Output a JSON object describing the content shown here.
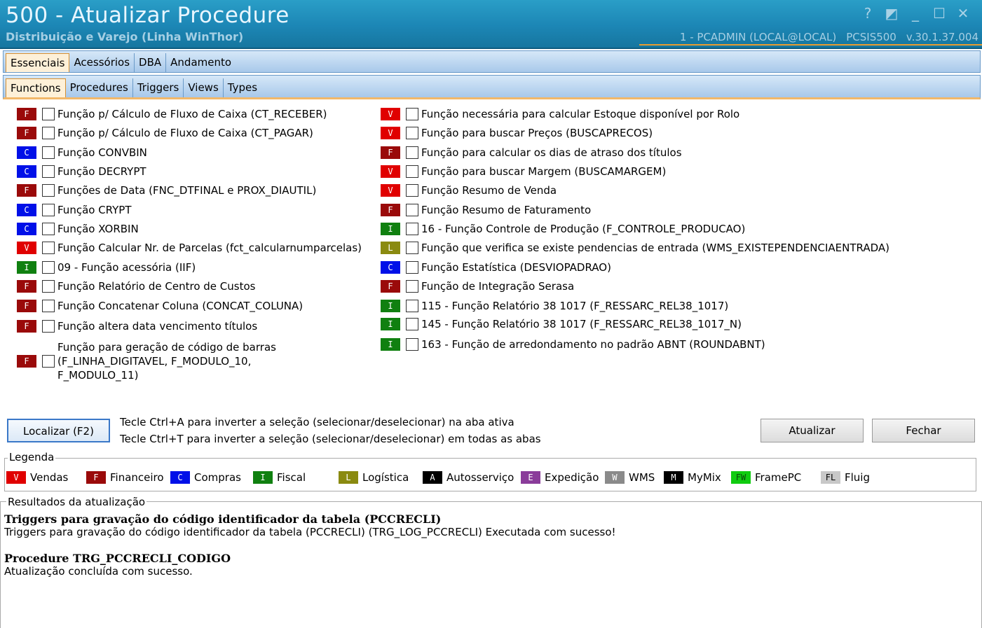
{
  "window": {
    "title": "500 - Atualizar Procedure",
    "subtitle": "Distribuição e Varejo (Linha WinThor)",
    "user": "1 - PCADMIN (LOCAL@LOCAL)",
    "program": "PCSIS500",
    "version": "v.30.1.37.004",
    "controls": [
      "?",
      "◩",
      "_",
      "☐",
      "✕"
    ]
  },
  "tabs_main": [
    {
      "label": "Essenciais",
      "active": true
    },
    {
      "label": "Acessórios",
      "active": false
    },
    {
      "label": "DBA",
      "active": false
    },
    {
      "label": "Andamento",
      "active": false
    }
  ],
  "tabs_sub": [
    {
      "label": "Functions",
      "active": true
    },
    {
      "label": "Procedures",
      "active": false
    },
    {
      "label": "Triggers",
      "active": false
    },
    {
      "label": "Views",
      "active": false
    },
    {
      "label": "Types",
      "active": false
    }
  ],
  "colors": {
    "V": "#e00000",
    "F": "#9a0a0a",
    "C": "#0010e8",
    "I": "#108010",
    "L": "#8a8a10",
    "A": "#000000",
    "E": "#8a3c9a",
    "W": "#8a8a8a",
    "M": "#000000",
    "FW": "#10cc10",
    "FL": "#c8c8c8"
  },
  "functions_left": [
    {
      "type": "F",
      "label": "Função p/ Cálculo de Fluxo de Caixa (CT_RECEBER)"
    },
    {
      "type": "F",
      "label": "Função p/ Cálculo de Fluxo de Caixa (CT_PAGAR)"
    },
    {
      "type": "C",
      "label": "Função CONVBIN"
    },
    {
      "type": "C",
      "label": "Função DECRYPT"
    },
    {
      "type": "F",
      "label": "Funções de Data (FNC_DTFINAL e PROX_DIAUTIL)"
    },
    {
      "type": "C",
      "label": "Função CRYPT"
    },
    {
      "type": "C",
      "label": "Função XORBIN"
    },
    {
      "type": "V",
      "label": "Função Calcular Nr. de Parcelas (fct_calcularnumparcelas)"
    },
    {
      "type": "I",
      "label": "09 - Função acessória (IIF)"
    },
    {
      "type": "F",
      "label": "Função Relatório de Centro de Custos"
    },
    {
      "type": "F",
      "label": "Função Concatenar Coluna (CONCAT_COLUNA)"
    },
    {
      "type": "F",
      "label": "Função altera data vencimento títulos"
    },
    {
      "type": "F",
      "label": "Função para geração de código de barras\n(F_LINHA_DIGITAVEL, F_MODULO_10,\nF_MODULO_11)"
    }
  ],
  "functions_right": [
    {
      "type": "V",
      "label": "Função necessária para calcular Estoque disponível por Rolo"
    },
    {
      "type": "V",
      "label": "Função para buscar Preços (BUSCAPRECOS)"
    },
    {
      "type": "F",
      "label": "Função para calcular os dias de atraso dos títulos"
    },
    {
      "type": "V",
      "label": "Função para buscar Margem (BUSCAMARGEM)"
    },
    {
      "type": "V",
      "label": "Função Resumo de Venda"
    },
    {
      "type": "F",
      "label": "Função Resumo de Faturamento"
    },
    {
      "type": "I",
      "label": "16 - Função Controle de Produção (F_CONTROLE_PRODUCAO)"
    },
    {
      "type": "L",
      "label": "Função que verifica se existe pendencias de entrada (WMS_EXISTEPENDENCIAENTRADA)"
    },
    {
      "type": "C",
      "label": "Função Estatística (DESVIOPADRAO)"
    },
    {
      "type": "F",
      "label": "Função de Integração Serasa"
    },
    {
      "type": "I",
      "label": "115 - Função Relatório 38 1017 (F_RESSARC_REL38_1017)"
    },
    {
      "type": "I",
      "label": "145 - Função Relatório 38 1017 (F_RESSARC_REL38_1017_N)"
    },
    {
      "type": "I",
      "label": "163 - Função de arredondamento no padrão ABNT (ROUNDABNT)"
    }
  ],
  "actions": {
    "localizar": "Localizar (F2)",
    "hint1": "Tecle Ctrl+A para inverter a seleção (selecionar/deselecionar) na aba ativa",
    "hint2": "Tecle Ctrl+T para inverter a seleção (selecionar/deselecionar) em todas as abas",
    "atualizar": "Atualizar",
    "fechar": "Fechar"
  },
  "legend": {
    "title": "Legenda",
    "items": [
      {
        "code": "V",
        "label": "Vendas"
      },
      {
        "code": "F",
        "label": "Financeiro"
      },
      {
        "code": "C",
        "label": "Compras"
      },
      {
        "code": "I",
        "label": "Fiscal"
      },
      {
        "code": "L",
        "label": "Logística"
      },
      {
        "code": "A",
        "label": "Autosserviço"
      },
      {
        "code": "E",
        "label": "Expedição"
      },
      {
        "code": "W",
        "label": "WMS"
      },
      {
        "code": "M",
        "label": "MyMix"
      },
      {
        "code": "FW",
        "label": "FramePC"
      },
      {
        "code": "FL",
        "label": "Fluig"
      }
    ]
  },
  "results": {
    "title": "Resultados da atualização",
    "heading1": "Triggers para gravação do código identificador da tabela (PCCRECLI)",
    "line1": "Triggers para gravação do código identificador da tabela (PCCRECLI) (TRG_LOG_PCCRECLI) Executada com sucesso!",
    "heading2": "Procedure TRG_PCCRECLI_CODIGO",
    "line2": "Atualização concluída com sucesso."
  }
}
